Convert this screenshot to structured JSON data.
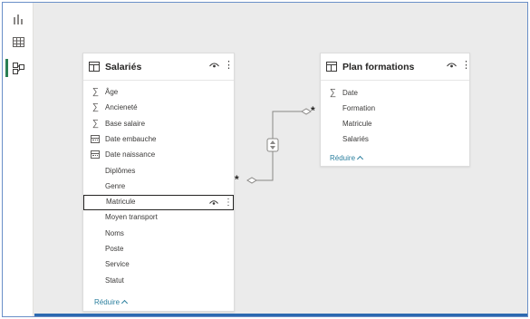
{
  "rail": {
    "items": [
      {
        "name": "report-view",
        "icon": "bar-chart-icon"
      },
      {
        "name": "data-view",
        "icon": "table-grid-icon"
      },
      {
        "name": "model-view",
        "icon": "model-diagram-icon",
        "active": true
      }
    ],
    "active_color": "#2b7f54"
  },
  "tables": {
    "salaries": {
      "title": "Salariés",
      "fields": [
        {
          "label": "Âge",
          "type": "sum"
        },
        {
          "label": "Ancieneté",
          "type": "sum"
        },
        {
          "label": "Base salaire",
          "type": "sum"
        },
        {
          "label": "Date embauche",
          "type": "date"
        },
        {
          "label": "Date naissance",
          "type": "date"
        },
        {
          "label": "Diplômes",
          "type": "text"
        },
        {
          "label": "Genre",
          "type": "text"
        },
        {
          "label": "Matricule",
          "type": "text",
          "selected": true
        },
        {
          "label": "Moyen transport",
          "type": "text"
        },
        {
          "label": "Noms",
          "type": "text"
        },
        {
          "label": "Poste",
          "type": "text"
        },
        {
          "label": "Service",
          "type": "text"
        },
        {
          "label": "Statut",
          "type": "text"
        }
      ],
      "reduce_label": "Réduire"
    },
    "plan_formations": {
      "title": "Plan formations",
      "fields": [
        {
          "label": "Date",
          "type": "sum"
        },
        {
          "label": "Formation",
          "type": "text"
        },
        {
          "label": "Matricule",
          "type": "text"
        },
        {
          "label": "Salariés",
          "type": "text"
        }
      ],
      "reduce_label": "Réduire"
    }
  },
  "relationship": {
    "from_cardinality": "*",
    "to_cardinality": "*",
    "filter_direction": "both"
  },
  "glyphs": {
    "sum": "∑",
    "more": "⋮"
  },
  "colors": {
    "accent": "#2b7f9e",
    "rail_active": "#2b7f54",
    "frame_border": "#6a8fc8"
  }
}
